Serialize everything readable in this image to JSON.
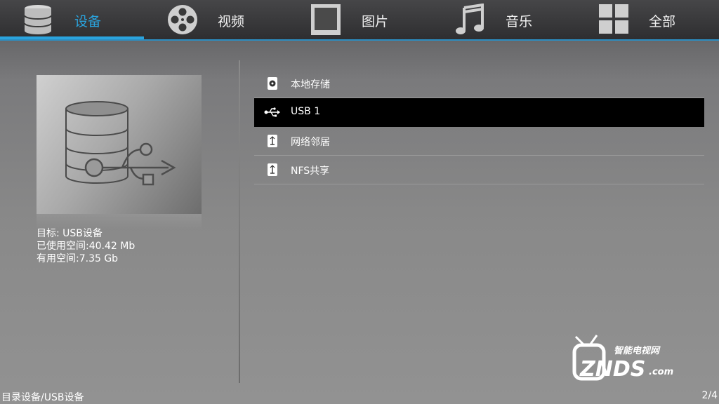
{
  "tabs": [
    {
      "label": "设备",
      "icon": "database-icon",
      "active": true
    },
    {
      "label": "视频",
      "icon": "film-reel-icon",
      "active": false
    },
    {
      "label": "图片",
      "icon": "picture-frame-icon",
      "active": false
    },
    {
      "label": "音乐",
      "icon": "music-note-icon",
      "active": false
    },
    {
      "label": "全部",
      "icon": "grid-icon",
      "active": false
    }
  ],
  "info": {
    "target": "目标: USB设备",
    "used": "已使用空间:40.42 Mb",
    "free": "有用空间:7.35 Gb"
  },
  "devices": [
    {
      "label": "本地存储",
      "icon": "hard-disk-icon",
      "selected": false
    },
    {
      "label": "USB 1",
      "icon": "usb-icon",
      "selected": true
    },
    {
      "label": "网络邻居",
      "icon": "network-share-icon",
      "selected": false
    },
    {
      "label": "NFS共享",
      "icon": "nfs-share-icon",
      "selected": false
    }
  ],
  "footer": {
    "path": "目录设备/USB设备",
    "page": "2/4"
  },
  "watermark": {
    "line1": "智能电视网",
    "line2": "ZNDS",
    "line3": ".com"
  },
  "colors": {
    "accent": "#2aa3dd",
    "selected_row": "#000000"
  }
}
